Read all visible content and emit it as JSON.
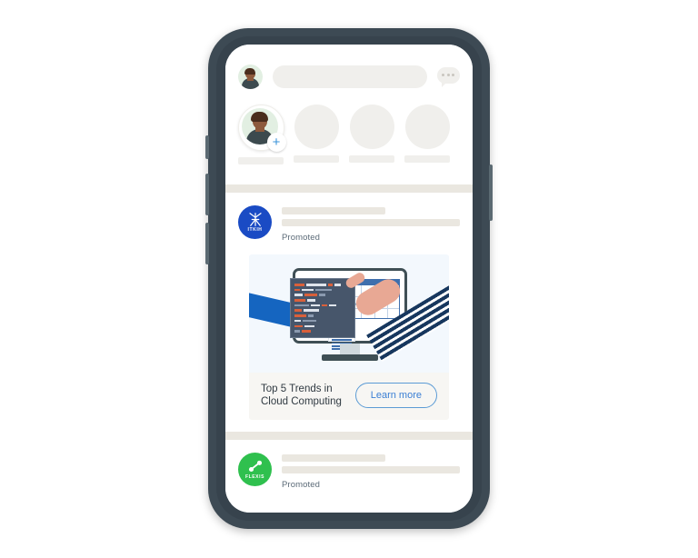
{
  "device": {
    "type": "smartphone-mockup",
    "frame_color": "#3d4a54",
    "screen_bg": "#ffffff"
  },
  "header": {
    "avatar": "user-avatar",
    "search_placeholder": "",
    "message_icon": "message-bubble-icon"
  },
  "stories": {
    "items": [
      {
        "id": "my-story",
        "label": "",
        "has_add_badge": true,
        "badge": "+"
      },
      {
        "id": "story-2",
        "label": "",
        "has_add_badge": false,
        "badge": ""
      },
      {
        "id": "story-3",
        "label": "",
        "has_add_badge": false,
        "badge": ""
      },
      {
        "id": "story-4",
        "label": "",
        "has_add_badge": false,
        "badge": ""
      }
    ]
  },
  "feed": {
    "posts": [
      {
        "id": "post-itkih",
        "brand": {
          "name": "ITKIH",
          "logo_color": "#1a4bc4",
          "logo_mark": "abstract-k-symbol"
        },
        "status": "Promoted",
        "ad": {
          "headline": "Top 5 Trends in Cloud Computing",
          "cta_label": "Learn more",
          "cta_color": "#3b7fd4",
          "image_alt": "illustration-desktop-monitor-with-code-and-chart-two-hands-pointing",
          "image_bg": "#f3f8fd",
          "caption_bg": "#f7f6f3"
        }
      },
      {
        "id": "post-flexis",
        "brand": {
          "name": "FLEXIS",
          "logo_color": "#2fc04e",
          "logo_mark": "dumbbell-symbol"
        },
        "status": "Promoted",
        "ad": null
      }
    ]
  },
  "colors": {
    "frame": "#3d4a54",
    "placeholder": "#eae7e0",
    "band": "#eae7e0",
    "promoted_text": "#5c6b78",
    "accent_blue": "#1a4bc4",
    "accent_green": "#2fc04e",
    "cta_blue": "#3b7fd4"
  }
}
